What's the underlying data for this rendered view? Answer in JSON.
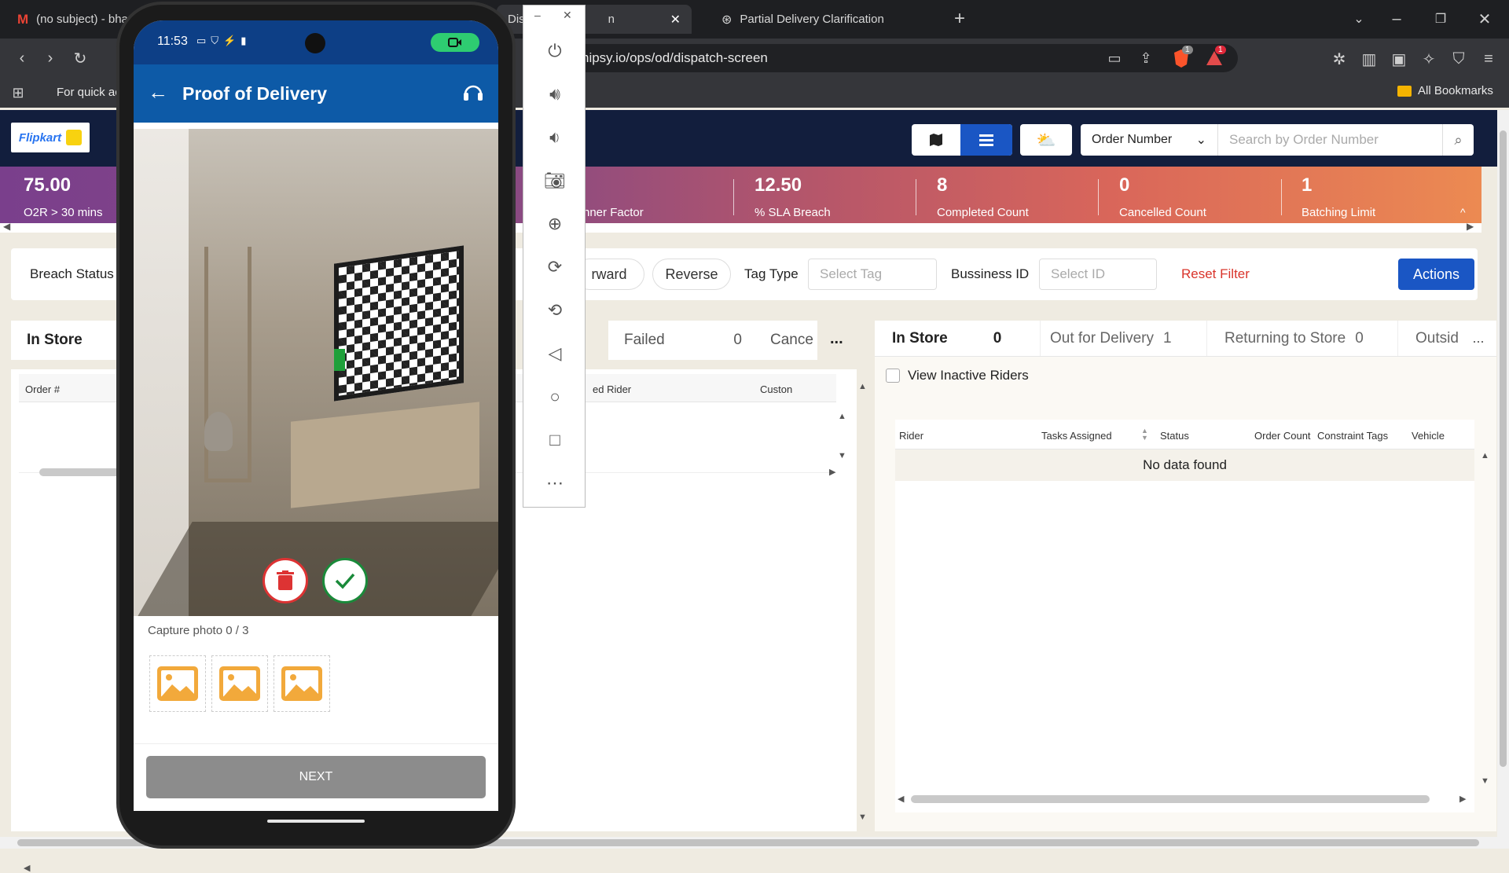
{
  "browser": {
    "tabs": [
      {
        "label": "(no subject) - bha"
      },
      {
        "label": "Dis"
      },
      {
        "label": "n"
      },
      {
        "label": "Partial Delivery Clarification"
      }
    ],
    "url": "hipsy.io/ops/od/dispatch-screen",
    "bookmarks_hint": "For quick ac",
    "all_bookmarks": "All Bookmarks",
    "badge1": "1",
    "badge2": "1"
  },
  "app": {
    "logo": "Flipkart",
    "search_type": "Order Number",
    "search_placeholder": "Search by Order Number",
    "stats": [
      {
        "value": "75.00",
        "label": "O2R > 30 mins"
      },
      {
        "value": "",
        "label": "nner Factor"
      },
      {
        "value": "12.50",
        "label": "% SLA Breach"
      },
      {
        "value": "8",
        "label": "Completed Count"
      },
      {
        "value": "0",
        "label": "Cancelled Count"
      },
      {
        "value": "1",
        "label": "Batching Limit"
      }
    ],
    "filters": {
      "breach_status": "Breach Status",
      "forward": "rward",
      "reverse": "Reverse",
      "tag_type": "Tag Type",
      "tag_placeholder": "Select Tag",
      "business_id": "Bussiness ID",
      "id_placeholder": "Select ID",
      "reset": "Reset Filter",
      "actions": "Actions"
    },
    "left_tabs": [
      {
        "label": "In Store"
      },
      {
        "label": "Failed",
        "count": "0"
      },
      {
        "label": "Cance"
      }
    ],
    "left_columns": [
      "Order #",
      "ed Rider",
      "Custon"
    ],
    "right_tabs": [
      {
        "label": "In Store",
        "count": "0"
      },
      {
        "label": "Out for Delivery",
        "count": "1"
      },
      {
        "label": "Returning to Store",
        "count": "0"
      },
      {
        "label": "Outsid"
      }
    ],
    "view_inactive": "View Inactive Riders",
    "right_columns": [
      "Rider",
      "Tasks Assigned",
      "Status",
      "Order Count",
      "Constraint Tags",
      "Vehicle"
    ],
    "no_data": "No data found",
    "more": "..."
  },
  "phone": {
    "time": "11:53",
    "title": "Proof of Delivery",
    "capture_label": "Capture photo 0 / 3",
    "next_label": "NEXT"
  },
  "colors": {
    "phone_header": "#0d5aa7",
    "actions_button": "#1a56c4",
    "reset_filter": "#d9342b",
    "thumbnail": "#f2a93b"
  }
}
